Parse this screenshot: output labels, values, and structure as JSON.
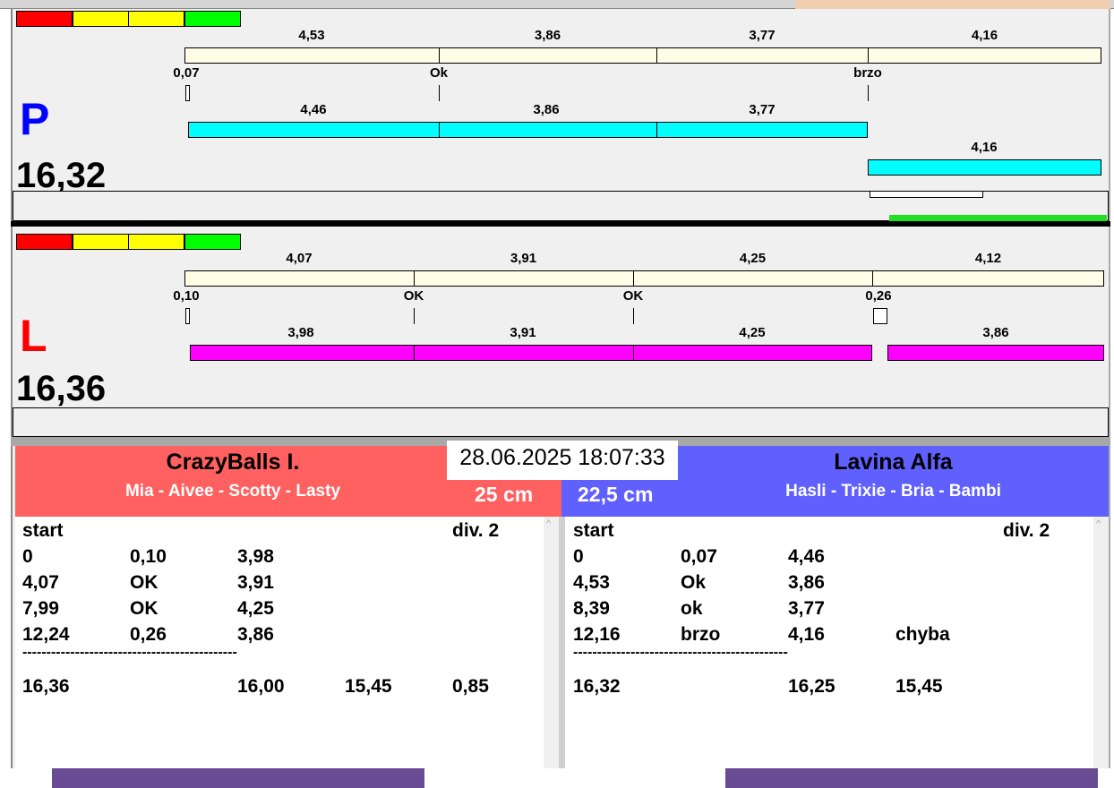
{
  "colors": {
    "ind": [
      "#ff0000",
      "#ffff00",
      "#ffff00",
      "#00ff00"
    ],
    "p_track": "#fffde6",
    "p_bar": "#00ffff",
    "l_bar": "#ff00ff",
    "team_left": "#ff6060",
    "team_right": "#6060ff",
    "letter_p": "#0000ff",
    "letter_l": "#ff0000"
  },
  "p": {
    "letter": "P",
    "total": "16,32",
    "top_labels": [
      "4,53",
      "3,86",
      "3,77",
      "4,16"
    ],
    "markers": [
      "0,07",
      "Ok",
      "brzo"
    ],
    "bar_labels": [
      "4,46",
      "3,86",
      "3,77",
      "4,16"
    ]
  },
  "l": {
    "letter": "L",
    "total": "16,36",
    "top_labels": [
      "4,07",
      "3,91",
      "4,25",
      "4,12"
    ],
    "markers": [
      "0,10",
      "OK",
      "OK",
      "0,26"
    ],
    "bar_labels": [
      "3,98",
      "3,91",
      "4,25",
      "3,86"
    ]
  },
  "timestamp": "28.06.2025 18:07:33",
  "left_team": {
    "name": "CrazyBalls I.",
    "dogs": "Mia - Aivee - Scotty - Lasty",
    "height": "25 cm",
    "start": "start",
    "div": "div.  2",
    "rows": [
      [
        "0",
        "0,10",
        "3,98",
        ""
      ],
      [
        "4,07",
        "OK",
        "3,91",
        ""
      ],
      [
        "7,99",
        "OK",
        "4,25",
        ""
      ],
      [
        "12,24",
        "0,26",
        "3,86",
        ""
      ]
    ],
    "sep": "---------------------------------------------",
    "totals": [
      "16,36",
      "",
      "16,00",
      "15,45",
      "0,85"
    ]
  },
  "right_team": {
    "name": "Lavina Alfa",
    "dogs": "Hasli - Trixie - Bria - Bambi",
    "height": "22,5 cm",
    "start": "start",
    "div": "div.  2",
    "rows": [
      [
        "0",
        "0,07",
        "4,46",
        ""
      ],
      [
        "4,53",
        "Ok",
        "3,86",
        ""
      ],
      [
        "8,39",
        "ok",
        "3,77",
        ""
      ],
      [
        "12,16",
        "brzo",
        "4,16",
        "chyba"
      ]
    ],
    "sep": "---------------------------------------------",
    "totals": [
      "16,32",
      "",
      "16,25",
      "15,45",
      ""
    ]
  }
}
